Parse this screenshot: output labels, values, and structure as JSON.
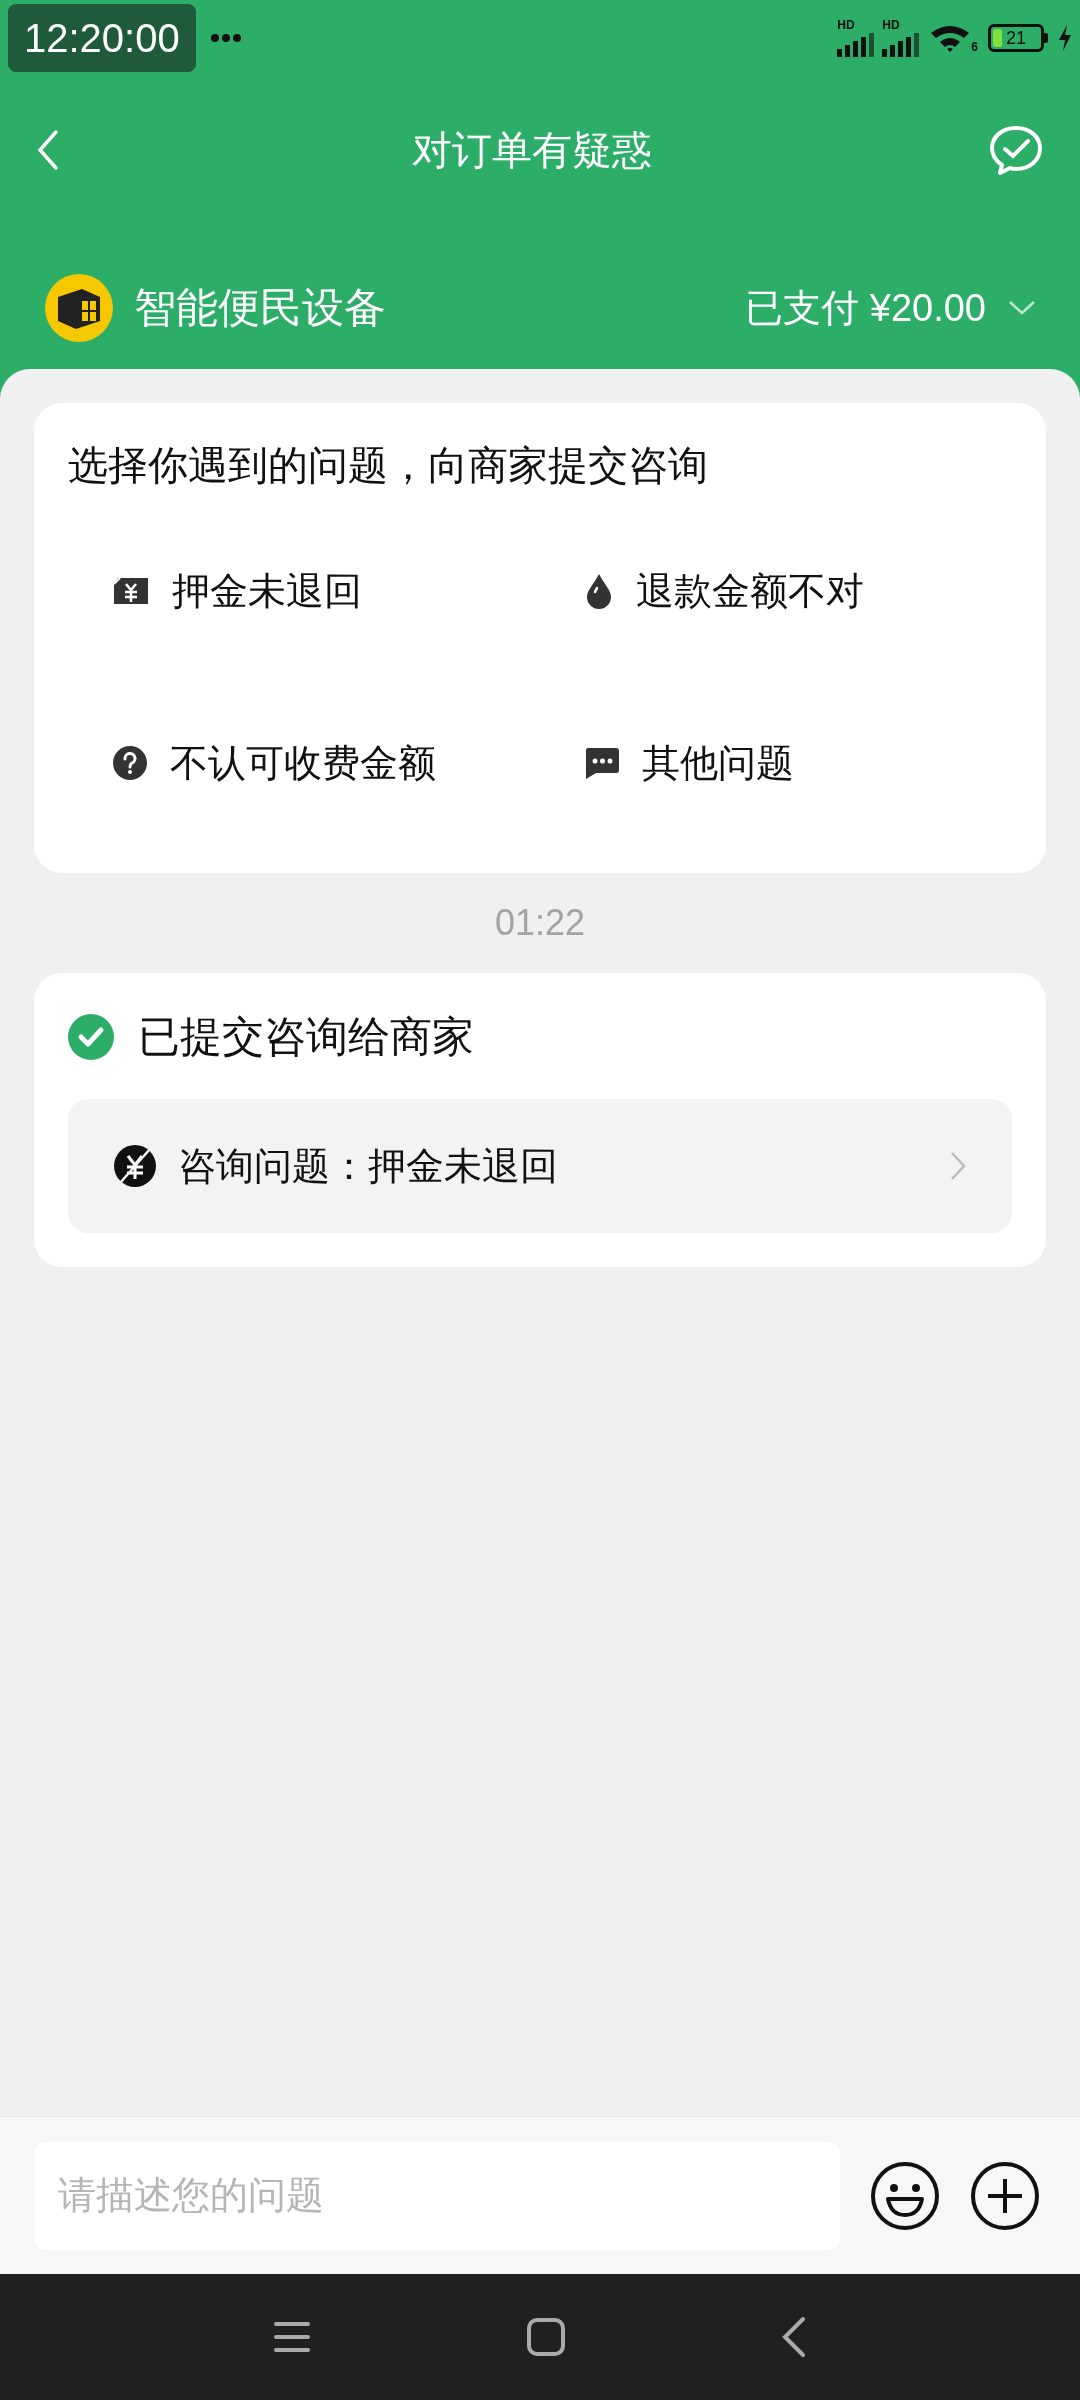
{
  "status_bar": {
    "time": "12:20:00",
    "signals": [
      "HD",
      "HD"
    ],
    "wifi": "6",
    "battery": "21",
    "charging": true
  },
  "header": {
    "title": "对订单有疑惑"
  },
  "merchant": {
    "name": "智能便民设备",
    "payment": "已支付 ¥20.00"
  },
  "question_card": {
    "title": "选择你遇到的问题，向商家提交咨询",
    "options": [
      {
        "kind": "deposit",
        "label": "押金未退回"
      },
      {
        "kind": "drop",
        "label": "退款金额不对"
      },
      {
        "kind": "question",
        "label": "不认可收费金额"
      },
      {
        "kind": "chat",
        "label": "其他问题"
      }
    ]
  },
  "timestamp": "01:22",
  "submitted_card": {
    "title": "已提交咨询给商家",
    "question": "咨询问题：押金未退回"
  },
  "input": {
    "placeholder": "请描述您的问题"
  }
}
